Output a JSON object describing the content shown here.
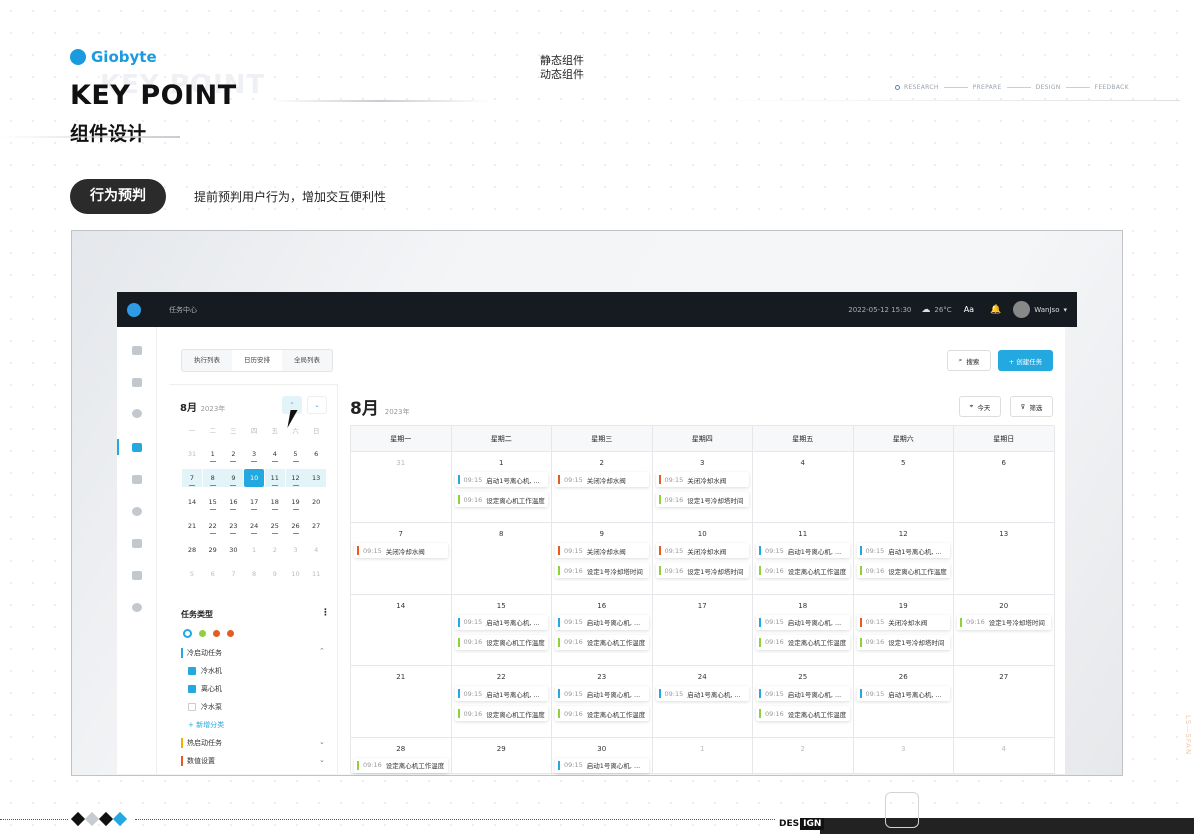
{
  "brand": {
    "logo_text": "Giobyte",
    "ghost_text": "KEY POINT",
    "title": "KEY POINT",
    "subtitle": "组件设计"
  },
  "center_labels": [
    "静态组件",
    "动态组件"
  ],
  "steps": [
    "RESEARCH",
    "PREPARE",
    "DESIGN",
    "FEEDBACK"
  ],
  "section": {
    "pill": "行为预判",
    "desc": "提前预判用户行为，增加交互便利性"
  },
  "app": {
    "nav_title": "任务中心",
    "datetime": "2022-05-12  15:30",
    "weather": "26°C",
    "font_btn": "Aa",
    "user": "WanJso",
    "tabs": [
      "执行列表",
      "日历安排",
      "全局列表"
    ],
    "search_label": "搜索",
    "create_label": "+ 创建任务",
    "today_label": "今天",
    "filter_label": "筛选",
    "mini": {
      "month": "8月",
      "year": "2023年",
      "weekdays": [
        "一",
        "二",
        "三",
        "四",
        "五",
        "六",
        "日"
      ],
      "rows": [
        [
          "31",
          "1",
          "2",
          "3",
          "4",
          "5",
          "6"
        ],
        [
          "7",
          "8",
          "9",
          "10",
          "11",
          "12",
          "13"
        ],
        [
          "14",
          "15",
          "16",
          "17",
          "18",
          "19",
          "20"
        ],
        [
          "21",
          "22",
          "23",
          "24",
          "25",
          "26",
          "27"
        ],
        [
          "28",
          "29",
          "30",
          "1",
          "2",
          "3",
          "4"
        ],
        [
          "5",
          "6",
          "7",
          "8",
          "9",
          "10",
          "11"
        ]
      ]
    },
    "types": {
      "title": "任务类型",
      "groups": [
        {
          "label": "冷启动任务",
          "color": "#23a8df",
          "items": [
            "冷水机",
            "离心机",
            "冷水泵"
          ],
          "add": "+ 新增分类"
        },
        {
          "label": "热启动任务",
          "color": "#f0b000"
        },
        {
          "label": "数值设置",
          "color": "#e85a20"
        }
      ]
    },
    "cal": {
      "month": "8月",
      "year": "2023年",
      "weekdays": [
        "星期一",
        "星期二",
        "星期三",
        "星期四",
        "星期五",
        "星期六",
        "星期日"
      ],
      "weeks": [
        [
          {
            "d": "31",
            "g": true
          },
          {
            "d": "1",
            "ev": [
              [
                "09:15",
                "启动1号离心机, ...",
                "#23a8df"
              ],
              [
                "09:16",
                "设定离心机工作温度",
                "#8ed13a"
              ]
            ]
          },
          {
            "d": "2",
            "ev": [
              [
                "09:15",
                "关闭冷却水阀",
                "#e85a20"
              ]
            ]
          },
          {
            "d": "3",
            "ev": [
              [
                "09:15",
                "关闭冷却水阀",
                "#e85a20"
              ],
              [
                "09:16",
                "设定1号冷却塔时间",
                "#8ed13a"
              ]
            ]
          },
          {
            "d": "4"
          },
          {
            "d": "5"
          },
          {
            "d": "6"
          }
        ],
        [
          {
            "d": "7",
            "ev": [
              [
                "09:15",
                "关闭冷却水阀",
                "#e85a20"
              ]
            ]
          },
          {
            "d": "8"
          },
          {
            "d": "9",
            "ev": [
              [
                "09:15",
                "关闭冷却水阀",
                "#e85a20"
              ],
              [
                "09:16",
                "设定1号冷却塔时间",
                "#8ed13a"
              ]
            ]
          },
          {
            "d": "10",
            "ev": [
              [
                "09:15",
                "关闭冷却水阀",
                "#e85a20"
              ],
              [
                "09:16",
                "设定1号冷却塔时间",
                "#8ed13a"
              ]
            ]
          },
          {
            "d": "11",
            "ev": [
              [
                "09:15",
                "启动1号离心机, ...",
                "#23a8df"
              ],
              [
                "09:16",
                "设定离心机工作温度",
                "#8ed13a"
              ]
            ]
          },
          {
            "d": "12",
            "ev": [
              [
                "09:15",
                "启动1号离心机, ...",
                "#23a8df"
              ],
              [
                "09:16",
                "设定离心机工作温度",
                "#8ed13a"
              ]
            ]
          },
          {
            "d": "13"
          }
        ],
        [
          {
            "d": "14"
          },
          {
            "d": "15",
            "ev": [
              [
                "09:15",
                "启动1号离心机, ...",
                "#23a8df"
              ],
              [
                "09:16",
                "设定离心机工作温度",
                "#8ed13a"
              ]
            ]
          },
          {
            "d": "16",
            "ev": [
              [
                "09:15",
                "启动1号离心机, ...",
                "#23a8df"
              ],
              [
                "09:16",
                "设定离心机工作温度",
                "#8ed13a"
              ]
            ]
          },
          {
            "d": "17"
          },
          {
            "d": "18",
            "ev": [
              [
                "09:15",
                "启动1号离心机, ...",
                "#23a8df"
              ],
              [
                "09:16",
                "设定离心机工作温度",
                "#8ed13a"
              ]
            ]
          },
          {
            "d": "19",
            "ev": [
              [
                "09:15",
                "关闭冷却水阀",
                "#e85a20"
              ],
              [
                "09:16",
                "设定1号冷却塔时间",
                "#8ed13a"
              ]
            ]
          },
          {
            "d": "20",
            "ev": [
              [
                "09:16",
                "设定1号冷却塔时间",
                "#8ed13a"
              ]
            ]
          }
        ],
        [
          {
            "d": "21"
          },
          {
            "d": "22",
            "ev": [
              [
                "09:15",
                "启动1号离心机, ...",
                "#23a8df"
              ],
              [
                "09:16",
                "设定离心机工作温度",
                "#8ed13a"
              ]
            ]
          },
          {
            "d": "23",
            "ev": [
              [
                "09:15",
                "启动1号离心机, ...",
                "#23a8df"
              ],
              [
                "09:16",
                "设定离心机工作温度",
                "#8ed13a"
              ]
            ]
          },
          {
            "d": "24",
            "ev": [
              [
                "09:15",
                "启动1号离心机, ...",
                "#23a8df"
              ]
            ]
          },
          {
            "d": "25",
            "ev": [
              [
                "09:15",
                "启动1号离心机, ...",
                "#23a8df"
              ],
              [
                "09:16",
                "设定离心机工作温度",
                "#8ed13a"
              ]
            ]
          },
          {
            "d": "26",
            "ev": [
              [
                "09:15",
                "启动1号离心机, ...",
                "#23a8df"
              ]
            ]
          },
          {
            "d": "27"
          }
        ],
        [
          {
            "d": "28",
            "ev": [
              [
                "09:16",
                "设定离心机工作温度",
                "#8ed13a"
              ]
            ]
          },
          {
            "d": "29"
          },
          {
            "d": "30",
            "ev": [
              [
                "09:15",
                "启动1号离心机, ...",
                "#23a8df"
              ]
            ]
          },
          {
            "d": "1",
            "g": true
          },
          {
            "d": "2",
            "g": true
          },
          {
            "d": "3",
            "g": true
          },
          {
            "d": "4",
            "g": true
          }
        ]
      ]
    }
  },
  "footer": {
    "des_a": "DES",
    "des_b": "IGN",
    "vertical": "LS—SFAN"
  }
}
